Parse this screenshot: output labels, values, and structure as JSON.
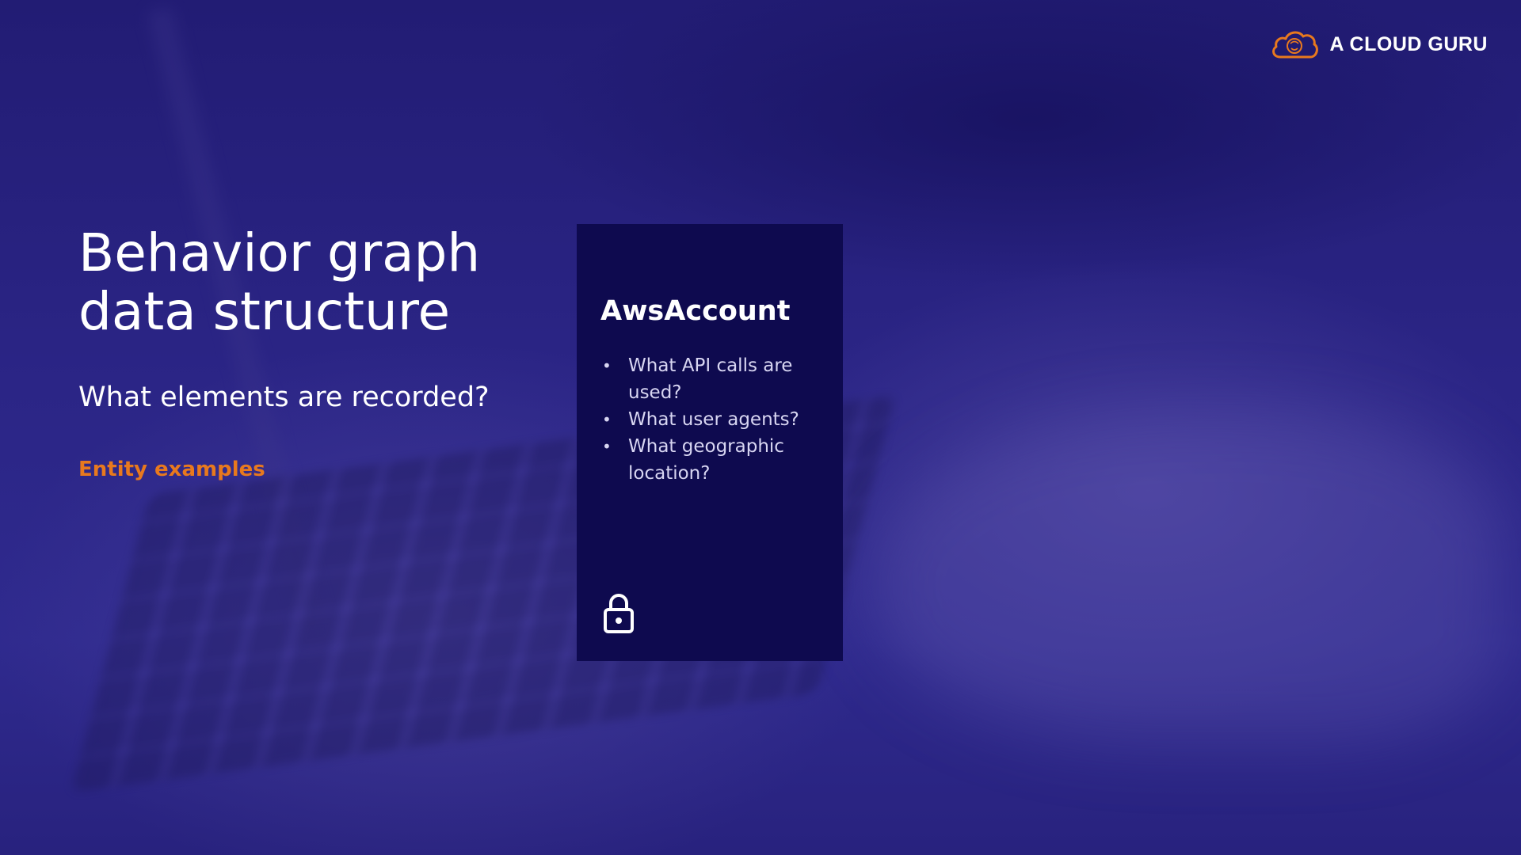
{
  "brand": {
    "name": "A CLOUD GURU",
    "logo_icon": "cloud-icon",
    "accent": "#e8791e"
  },
  "slide": {
    "title_line1": "Behavior graph",
    "title_line2": "data structure",
    "subtitle": "What elements are recorded?",
    "section_label": "Entity examples"
  },
  "card": {
    "title": "AwsAccount",
    "items": [
      "What API calls are used?",
      "What user agents?",
      "What geographic location?"
    ],
    "icon": "lock-icon"
  },
  "colors": {
    "background": "#2a2580",
    "card_background": "#0e0a4f",
    "accent": "#e8791e",
    "text": "#ffffff"
  }
}
